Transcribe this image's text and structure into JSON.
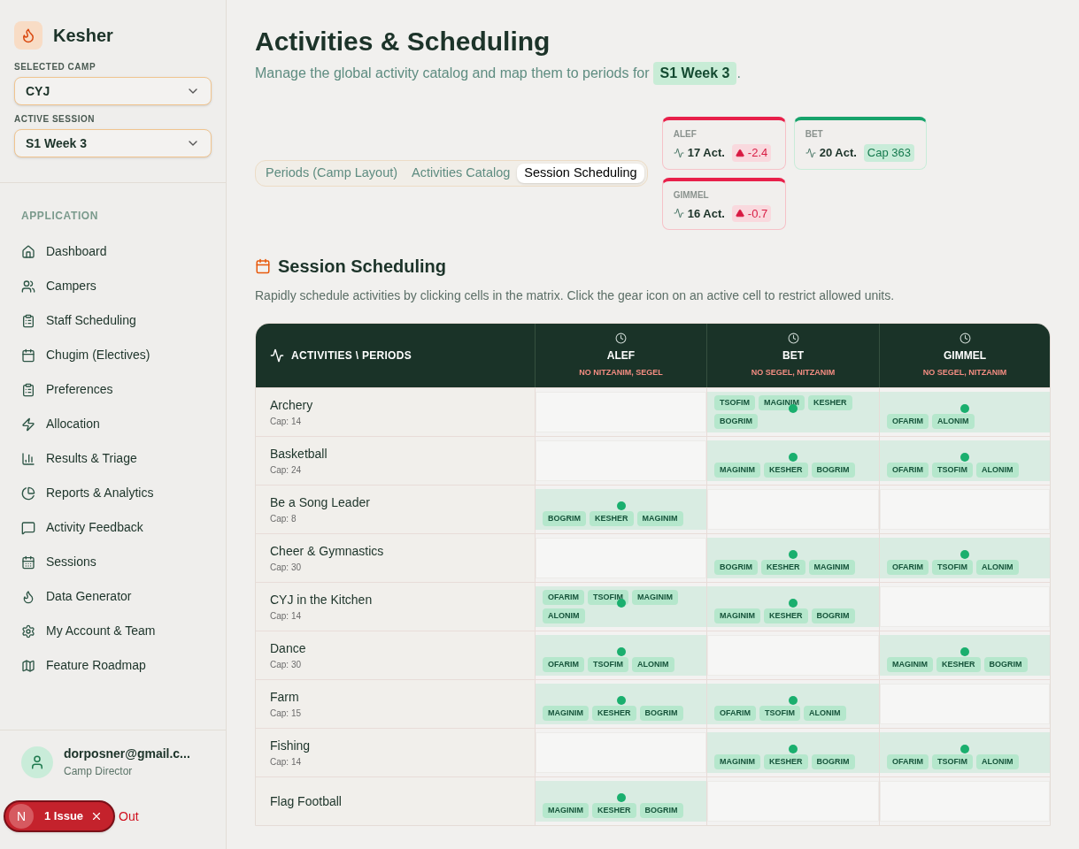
{
  "brand": {
    "name": "Kesher"
  },
  "selectors": [
    {
      "label": "SELECTED CAMP",
      "value": "CYJ"
    },
    {
      "label": "ACTIVE SESSION",
      "value": "S1 Week 3"
    }
  ],
  "sidebar": {
    "section": "APPLICATION",
    "items": [
      {
        "label": "Dashboard",
        "selected": false
      },
      {
        "label": "Campers",
        "selected": false
      },
      {
        "label": "Staff Scheduling",
        "selected": false
      },
      {
        "label": "Chugim (Electives)",
        "selected": false
      },
      {
        "label": "Preferences",
        "selected": false
      },
      {
        "label": "Allocation",
        "selected": false
      },
      {
        "label": "Results & Triage",
        "selected": false
      },
      {
        "label": "Reports & Analytics",
        "selected": false
      },
      {
        "label": "Activity Feedback",
        "selected": false
      },
      {
        "label": "Sessions",
        "selected": false
      },
      {
        "label": "Data Generator",
        "selected": false
      },
      {
        "label": "My Account & Team",
        "selected": false
      },
      {
        "label": "Feature Roadmap",
        "selected": false
      }
    ]
  },
  "user": {
    "email": "dorposner@gmail.c...",
    "role": "Camp Director",
    "signout": "Out"
  },
  "issue_badge": {
    "letter": "N",
    "text": "1 Issue"
  },
  "header": {
    "title": "Activities & Scheduling",
    "subtitle_prefix": "Manage the global activity catalog and map them to periods for",
    "session": "S1 Week 3",
    "subtitle_suffix": "."
  },
  "tabs": [
    {
      "label": "Periods (Camp Layout)",
      "selected": false
    },
    {
      "label": "Activities Catalog",
      "selected": false
    },
    {
      "label": "Session Scheduling",
      "selected": true
    }
  ],
  "period_stats": [
    {
      "name": "ALEF",
      "count": "17 Act.",
      "badge": "-2.4",
      "warning": true
    },
    {
      "name": "BET",
      "count": "20 Act.",
      "badge": "Cap 363",
      "warning": false
    },
    {
      "name": "GIMMEL",
      "count": "16 Act.",
      "badge": "-0.7",
      "warning": true
    }
  ],
  "section": {
    "title": "Session Scheduling",
    "description": "Rapidly schedule activities by clicking cells in the matrix. Click the gear icon on an active cell to restrict allowed units."
  },
  "matrix": {
    "corner": "ACTIVITIES \\ PERIODS",
    "columns": [
      {
        "name": "ALEF",
        "restriction": "NO NITZANIM, SEGEL"
      },
      {
        "name": "BET",
        "restriction": "NO SEGEL, NITZANIM"
      },
      {
        "name": "GIMMEL",
        "restriction": "NO SEGEL, NITZANIM"
      }
    ],
    "rows": [
      {
        "name": "Archery",
        "cap": "Cap: 14",
        "cells": [
          {
            "active": false
          },
          {
            "active": true,
            "units": [
              "TSOFIM",
              "MAGINIM",
              "KESHER",
              "BOGRIM"
            ]
          },
          {
            "active": true,
            "units": [
              "OFARIM",
              "ALONIM"
            ]
          }
        ]
      },
      {
        "name": "Basketball",
        "cap": "Cap: 24",
        "cells": [
          {
            "active": false
          },
          {
            "active": true,
            "units": [
              "MAGINIM",
              "KESHER",
              "BOGRIM"
            ]
          },
          {
            "active": true,
            "units": [
              "OFARIM",
              "TSOFIM",
              "ALONIM"
            ]
          }
        ]
      },
      {
        "name": "Be a Song Leader",
        "cap": "Cap: 8",
        "cells": [
          {
            "active": true,
            "units": [
              "BOGRIM",
              "KESHER",
              "MAGINIM"
            ]
          },
          {
            "active": false
          },
          {
            "active": false
          }
        ]
      },
      {
        "name": "Cheer & Gymnastics",
        "cap": "Cap: 30",
        "cells": [
          {
            "active": false
          },
          {
            "active": true,
            "units": [
              "BOGRIM",
              "KESHER",
              "MAGINIM"
            ]
          },
          {
            "active": true,
            "units": [
              "OFARIM",
              "TSOFIM",
              "ALONIM"
            ]
          }
        ]
      },
      {
        "name": "CYJ in the Kitchen",
        "cap": "Cap: 14",
        "cells": [
          {
            "active": true,
            "units": [
              "OFARIM",
              "TSOFIM",
              "MAGINIM",
              "ALONIM"
            ]
          },
          {
            "active": true,
            "units": [
              "MAGINIM",
              "KESHER",
              "BOGRIM"
            ]
          },
          {
            "active": false
          }
        ]
      },
      {
        "name": "Dance",
        "cap": "Cap: 30",
        "cells": [
          {
            "active": true,
            "units": [
              "OFARIM",
              "TSOFIM",
              "ALONIM"
            ]
          },
          {
            "active": false
          },
          {
            "active": true,
            "units": [
              "MAGINIM",
              "KESHER",
              "BOGRIM"
            ]
          }
        ]
      },
      {
        "name": "Farm",
        "cap": "Cap: 15",
        "cells": [
          {
            "active": true,
            "units": [
              "MAGINIM",
              "KESHER",
              "BOGRIM"
            ]
          },
          {
            "active": true,
            "units": [
              "OFARIM",
              "TSOFIM",
              "ALONIM"
            ]
          },
          {
            "active": false
          }
        ]
      },
      {
        "name": "Fishing",
        "cap": "Cap: 14",
        "cells": [
          {
            "active": false
          },
          {
            "active": true,
            "units": [
              "MAGINIM",
              "KESHER",
              "BOGRIM"
            ]
          },
          {
            "active": true,
            "units": [
              "OFARIM",
              "TSOFIM",
              "ALONIM"
            ]
          }
        ]
      },
      {
        "name": "Flag Football",
        "cells": [
          {
            "active": true,
            "units": [
              "MAGINIM",
              "KESHER",
              "BOGRIM"
            ]
          },
          {
            "active": false
          },
          {
            "active": false
          }
        ]
      }
    ]
  }
}
